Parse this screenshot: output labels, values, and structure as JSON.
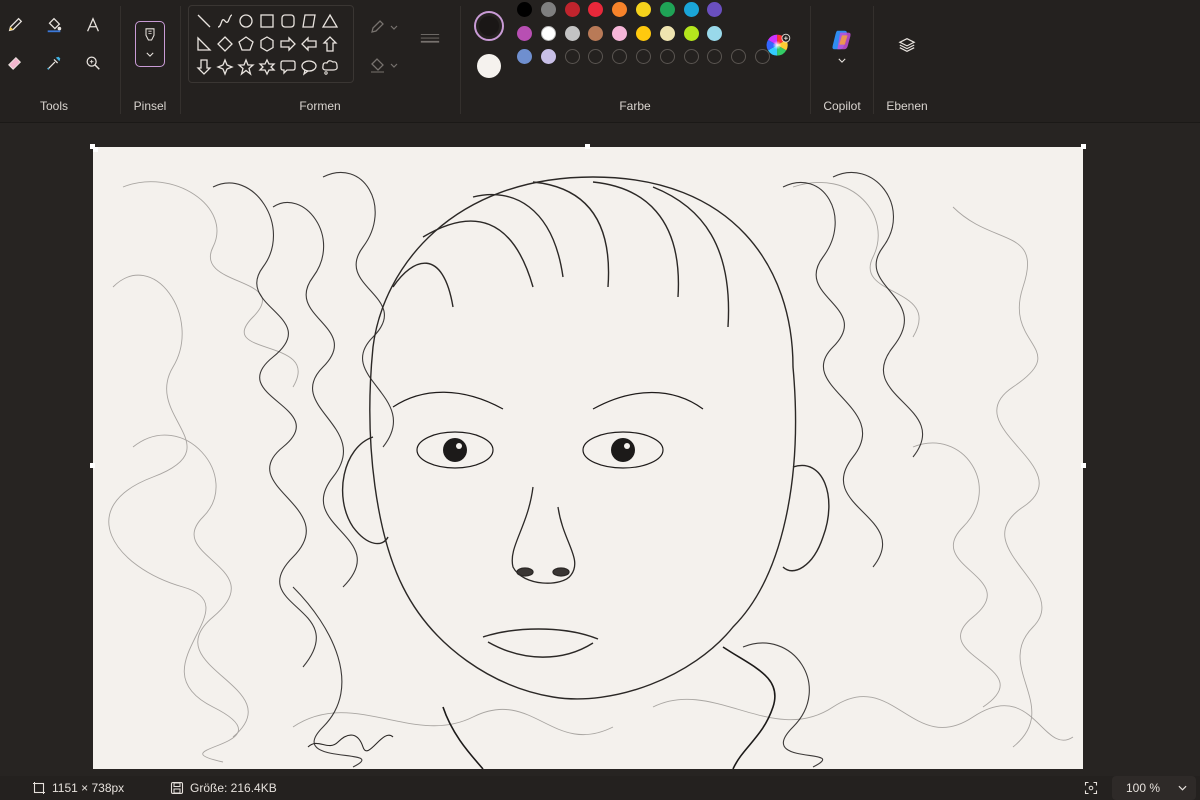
{
  "ribbon": {
    "groups": {
      "tools": "Tools",
      "brush": "Pinsel",
      "shapes": "Formen",
      "color": "Farbe",
      "copilot": "Copilot",
      "layers": "Ebenen"
    },
    "tools": [
      "pencil-icon",
      "fill-bucket-icon",
      "text-icon",
      "eraser-icon",
      "color-picker-icon",
      "magnifier-icon"
    ],
    "shapes": [
      "line",
      "curve",
      "oval",
      "rectangle",
      "rounded-rectangle",
      "polygon",
      "triangle",
      "right-triangle",
      "diamond",
      "pentagon",
      "hexagon",
      "right-arrow",
      "left-arrow",
      "up-arrow",
      "down-arrow",
      "four-point-star",
      "five-point-star",
      "six-point-star",
      "rounded-callout",
      "oval-callout",
      "cloud-callout"
    ],
    "colors": {
      "primary": "#1a1716",
      "secondary": "#f5f2ee",
      "row1": [
        "#000000",
        "#7f7f7f",
        "#c0242d",
        "#e8283a",
        "#f7832a",
        "#f5d21c",
        "#1fa356",
        "#1aa5d8",
        "#6a4fbf"
      ],
      "row2": [
        "#b84fb3",
        "#ffffff",
        "#c3c3c3",
        "#b97a57",
        "#f6b6d8",
        "#ffc90e",
        "#efe4b0",
        "#b5e61d",
        "#99d9ea"
      ],
      "row3": [
        "#6f8fcf",
        "#c8bfe7"
      ],
      "empty_slots": 9
    }
  },
  "status": {
    "dimensions": "1151 × 738px",
    "size": "Größe: 216.4KB",
    "zoom": "100 %"
  }
}
